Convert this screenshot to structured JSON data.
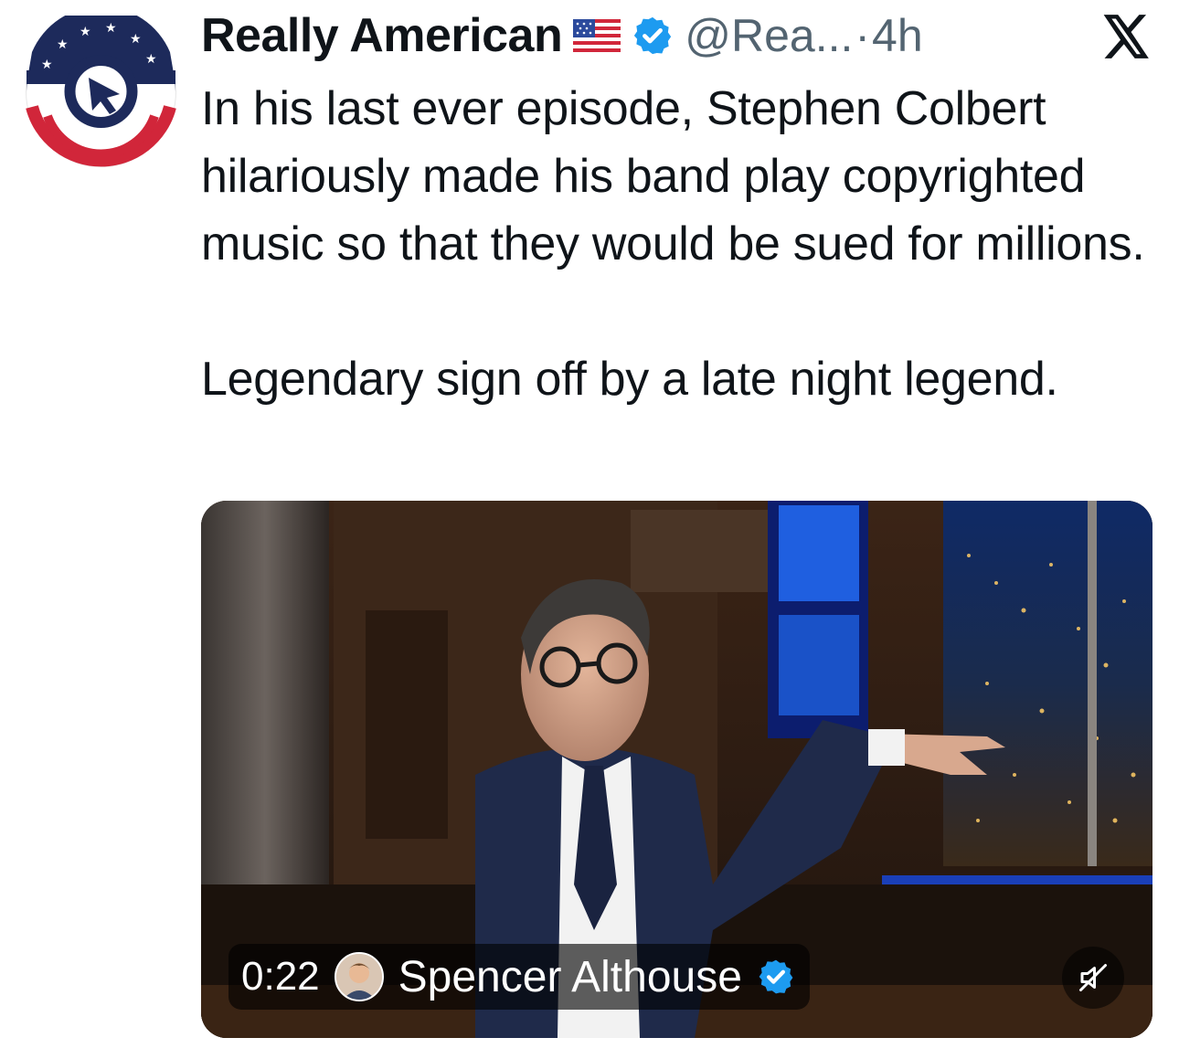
{
  "account": {
    "display_name": "Really American",
    "flag_emoji_icon": "us-flag-icon",
    "handle": "@Rea...",
    "separator": "·",
    "timestamp": "4h"
  },
  "tweet": {
    "paragraphs": [
      "In his last ever episode, Stephen Colbert hilariously made his band play copyrighted music so that they would be sued for millions.",
      "Legendary sign off by a late night legend."
    ]
  },
  "media": {
    "duration": "0:22",
    "credit_name": "Spencer Althouse",
    "mute_icon": "muted-speaker-icon"
  },
  "colors": {
    "verified_blue": "#1d9bf0",
    "handle_gray": "#536471",
    "brand_red": "#d1263a",
    "brand_navy": "#1d2a5b"
  }
}
